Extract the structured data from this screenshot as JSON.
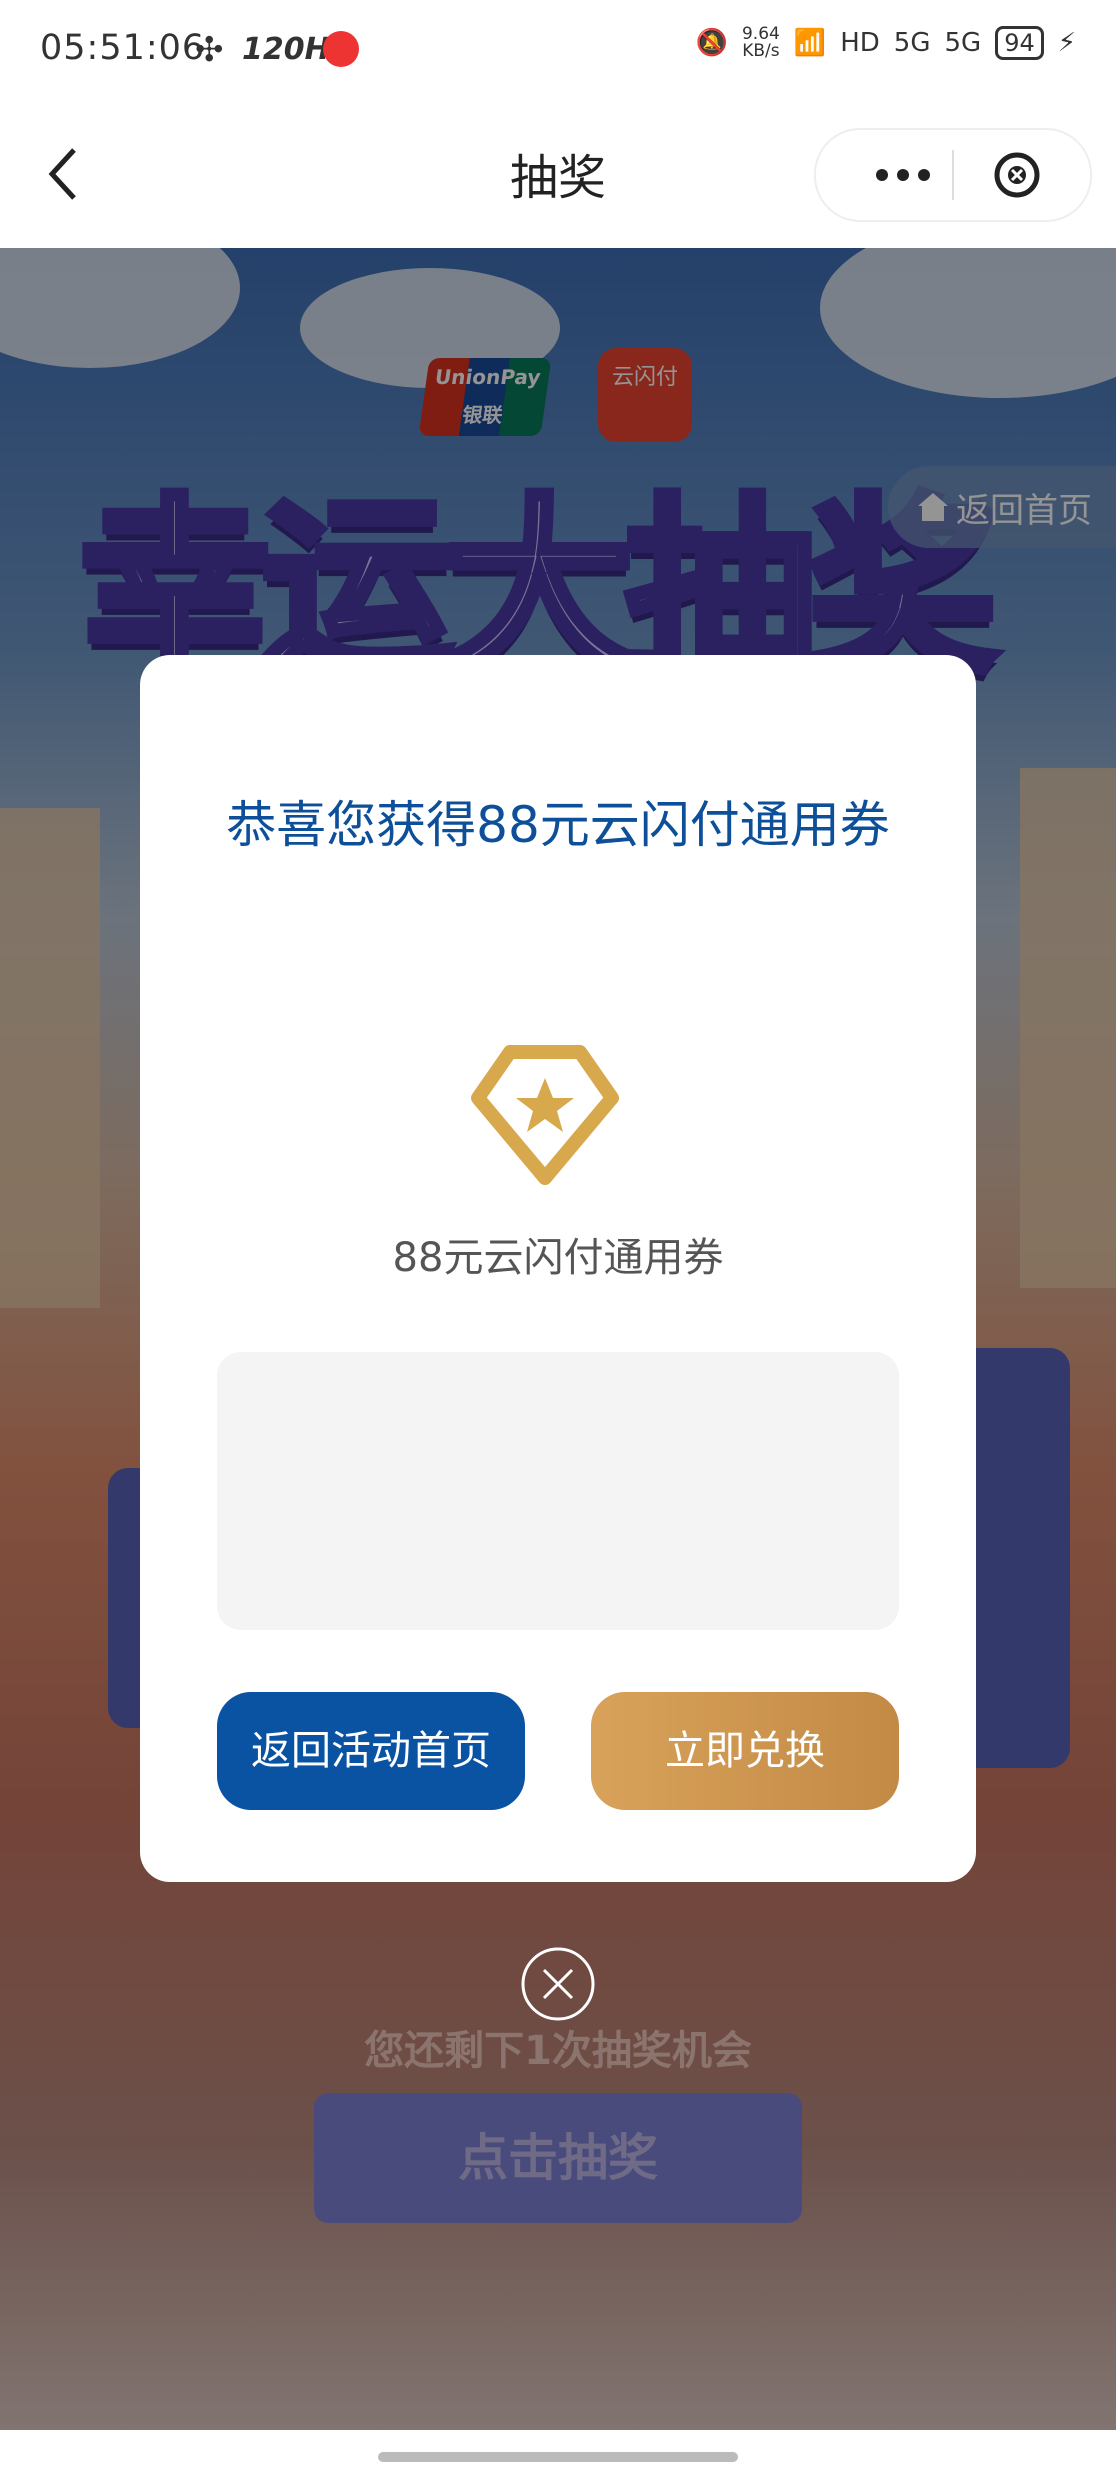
{
  "status_bar": {
    "time": "05:51:06",
    "refresh_rate": "120HZ",
    "net_speed_value": "9.64",
    "net_speed_unit": "KB/s",
    "hd_label": "HD",
    "signal_1": "5G",
    "signal_2": "5G",
    "battery": "94"
  },
  "nav": {
    "title": "抽奖"
  },
  "background": {
    "unionpay_logo_text": "UnionPay 银联",
    "yunshanfu_logo_text": "云闪付",
    "banner_title": "幸运大抽奖",
    "home_button_label": "返回首页",
    "remaining_text": "您还剩下1次抽奖机会",
    "draw_button_label": "点击抽奖"
  },
  "dialog": {
    "title": "恭喜您获得88元云闪付通用券",
    "prize_icon": "diamond-star-icon",
    "prize_name": "88元云闪付通用券",
    "back_button_label": "返回活动首页",
    "redeem_button_label": "立即兑换",
    "colors": {
      "title": "#0d4f99",
      "back_button": "#0a53a3",
      "redeem_button": "#c89450",
      "gem": "#d7a84c"
    }
  }
}
